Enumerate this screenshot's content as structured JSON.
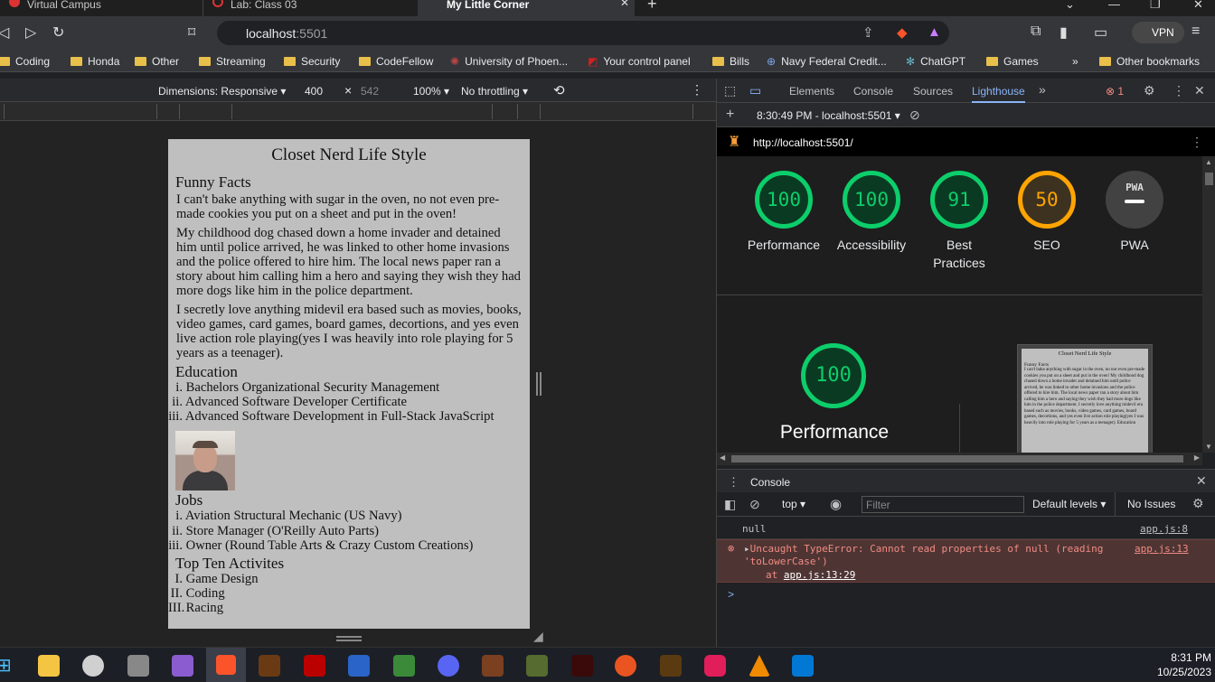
{
  "browser": {
    "tabs": [
      {
        "title": "Virtual Campus",
        "active": false
      },
      {
        "title": "Lab: Class 03",
        "active": false
      },
      {
        "title": "My Little Corner",
        "active": true
      }
    ],
    "new_tab": "+",
    "address": {
      "host": "localhost",
      "port": ":5501"
    },
    "vpn_label": "VPN",
    "bookmarks": [
      {
        "label": "Coding",
        "icon": "folder-icon"
      },
      {
        "label": "Honda",
        "icon": "folder-icon"
      },
      {
        "label": "Other",
        "icon": "folder-icon"
      },
      {
        "label": "Streaming",
        "icon": "folder-icon"
      },
      {
        "label": "Security",
        "icon": "folder-icon"
      },
      {
        "label": "CodeFellow",
        "icon": "folder-icon"
      },
      {
        "label": "University of Phoen...",
        "icon": "university-icon"
      },
      {
        "label": "Your control panel",
        "icon": "control-panel-icon"
      },
      {
        "label": "Bills",
        "icon": "folder-icon"
      },
      {
        "label": "Navy Federal Credit...",
        "icon": "globe-icon"
      },
      {
        "label": "ChatGPT",
        "icon": "chatgpt-icon"
      },
      {
        "label": "Games",
        "icon": "folder-icon"
      }
    ],
    "more_bookmarks": "»",
    "other_bookmarks": "Other bookmarks"
  },
  "device_toolbar": {
    "dimensions": "Dimensions: Responsive",
    "width": "400",
    "times": "×",
    "height": "542",
    "zoom": "100%",
    "throttling": "No throttling"
  },
  "page": {
    "title": "Closet Nerd Life Style",
    "facts_heading": "Funny Facts",
    "facts": [
      "I can't bake anything with sugar in the oven, no not even pre-made cookies you put on a sheet and put in the oven!",
      "My childhood dog chased down a home invader and detained him until police arrived, he was linked to other home invasions and the police offered to hire him. The local news paper ran a story about him calling him a hero and saying they wish they had more dogs like him in the police department.",
      "I secretly love anything midevil era based such as movies, books, video games, card games, board games, decortions, and yes even live action role playing(yes I was heavily into role playing for 5 years as a teenager)."
    ],
    "education_heading": "Education",
    "education": [
      {
        "num": "i.",
        "text": "Bachelors Organizational Security Management"
      },
      {
        "num": "ii.",
        "text": "Advanced Software Developer Certificate"
      },
      {
        "num": "iii.",
        "text": "Advanced Software Development in Full-Stack JavaScript"
      }
    ],
    "jobs_heading": "Jobs",
    "jobs": [
      {
        "num": "i.",
        "text": "Aviation Structural Mechanic (US Navy)"
      },
      {
        "num": "ii.",
        "text": "Store Manager (O'Reilly Auto Parts)"
      },
      {
        "num": "iii.",
        "text": "Owner (Round Table Arts & Crazy Custom Creations)"
      }
    ],
    "activities_heading": "Top Ten Activites",
    "activities": [
      {
        "num": "I.",
        "text": "Game Design"
      },
      {
        "num": "II.",
        "text": "Coding"
      },
      {
        "num": "III.",
        "text": "Racing"
      }
    ]
  },
  "devtools": {
    "tabs": [
      "Elements",
      "Console",
      "Sources",
      "Lighthouse"
    ],
    "active_tab": "Lighthouse",
    "more_tabs": "»",
    "error_count": "1",
    "lighthouse_run": "8:30:49 PM - localhost:5501",
    "report_url": "http://localhost:5501/",
    "scores": [
      {
        "label": "Performance",
        "value": "100",
        "color": "#0cce6b"
      },
      {
        "label": "Accessibility",
        "value": "100",
        "color": "#0cce6b"
      },
      {
        "label": "Best Practices",
        "value": "91",
        "color": "#0cce6b"
      },
      {
        "label": "SEO",
        "value": "50",
        "color": "#ffa400"
      },
      {
        "label": "PWA",
        "value": "PWA",
        "color": "#9e9e9e"
      }
    ],
    "big_score": {
      "label": "Performance",
      "value": "100"
    },
    "thumb": {
      "title": "Closet Nerd Life Style",
      "heading": "Funny Facts",
      "text": "I can't bake anything with sugar in the oven, no not even pre-made cookies you put on a sheet and put in the oven! My childhood dog chased down a home invader and detained him until police arrived, he was linked to other home invasions and the police offered to hire him. The local news paper ran a story about him calling him a hero and saying they wish they had more dogs like him in the police department. I secretly love anything midevil era based such as movies, books, video games, card games, board games, decortions, and yes even live action role playing(yes I was heavily into role playing for 5 years as a teenager). Education"
    },
    "console": {
      "tab_label": "Console",
      "context": "top",
      "filter_placeholder": "Filter",
      "levels": "Default levels",
      "issues": "No Issues",
      "log_text": "null",
      "log_source": "app.js:8",
      "error_text": "Uncaught TypeError: Cannot read properties of null (reading 'toLowerCase')",
      "error_at": "at ",
      "error_link": "app.js:13:29",
      "error_source": "app.js:13",
      "prompt": ">"
    }
  },
  "taskbar": {
    "time": "8:31 PM",
    "date": "10/25/2023"
  }
}
